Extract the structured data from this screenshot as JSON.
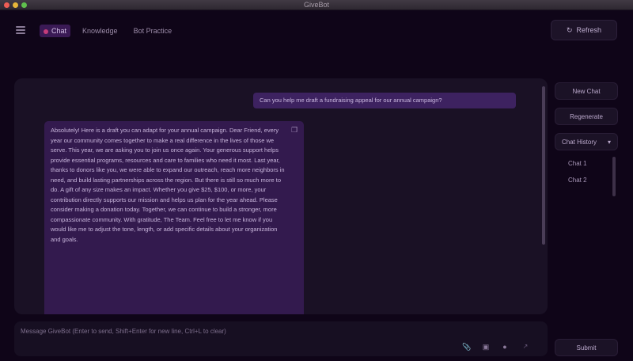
{
  "window": {
    "title": "GiveBot"
  },
  "appbar": {
    "tabs": [
      {
        "label": "Chat",
        "active": true
      },
      {
        "label": "Knowledge",
        "active": false
      },
      {
        "label": "Bot Practice",
        "active": false
      }
    ],
    "action_label": "Refresh",
    "action_icon": "refresh-icon"
  },
  "chat": {
    "user_message": "Can you help me draft a fundraising appeal for our annual campaign?",
    "bot_message": "Absolutely! Here is a draft you can adapt for your annual campaign. Dear Friend, every year our community comes together to make a real difference in the lives of those we serve. This year, we are asking you to join us once again. Your generous support helps provide essential programs, resources and care to families who need it most. Last year, thanks to donors like you, we were able to expand our outreach, reach more neighbors in need, and build lasting partnerships across the region. But there is still so much more to do. A gift of any size makes an impact. Whether you give $25, $100, or more, your contribution directly supports our mission and helps us plan for the year ahead. Please consider making a donation today. Together, we can continue to build a stronger, more compassionate community. With gratitude, The Team. Feel free to let me know if you would like me to adjust the tone, length, or add specific details about your organization and goals."
  },
  "input": {
    "placeholder": "Message GiveBot (Enter to send, Shift+Enter for new line, Ctrl+L to clear)"
  },
  "sidebar": {
    "buttons": [
      "New Chat",
      "Regenerate"
    ],
    "select_value": "Chat History",
    "history_items": [
      "Chat 1",
      "Chat 2"
    ],
    "send_label": "Submit"
  },
  "colors": {
    "accent": "#3d2260",
    "background": "#0f0518",
    "panel": "#1a1125",
    "active_tab_dot": "#c43c7a"
  }
}
